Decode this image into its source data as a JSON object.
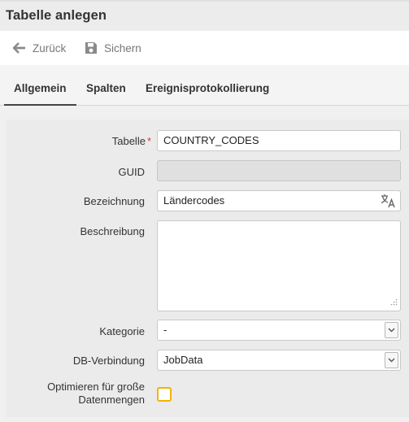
{
  "window": {
    "title": "Tabelle anlegen"
  },
  "toolbar": {
    "back_label": "Zurück",
    "save_label": "Sichern"
  },
  "tabs": [
    {
      "label": "Allgemein",
      "active": true
    },
    {
      "label": "Spalten",
      "active": false
    },
    {
      "label": "Ereignisprotokollierung",
      "active": false
    }
  ],
  "form": {
    "table": {
      "label": "Tabelle",
      "required_marker": "*",
      "value": "COUNTRY_CODES"
    },
    "guid": {
      "label": "GUID",
      "value": ""
    },
    "designation": {
      "label": "Bezeichnung",
      "value": "Ländercodes"
    },
    "description": {
      "label": "Beschreibung",
      "value": ""
    },
    "category": {
      "label": "Kategorie",
      "selected": "-"
    },
    "db_connection": {
      "label": "DB-Verbindung",
      "selected": "JobData"
    },
    "optimize": {
      "label_line1": "Optimieren für große",
      "label_line2": "Datenmengen",
      "checked": false
    }
  },
  "colors": {
    "accent_checkbox": "#f2b400",
    "required": "#d9383a",
    "panel_bg": "#ebebeb"
  },
  "icons": [
    "arrow-left-icon",
    "floppy-disk-icon",
    "translate-icon",
    "resize-grip-icon",
    "chevron-down-icon"
  ]
}
